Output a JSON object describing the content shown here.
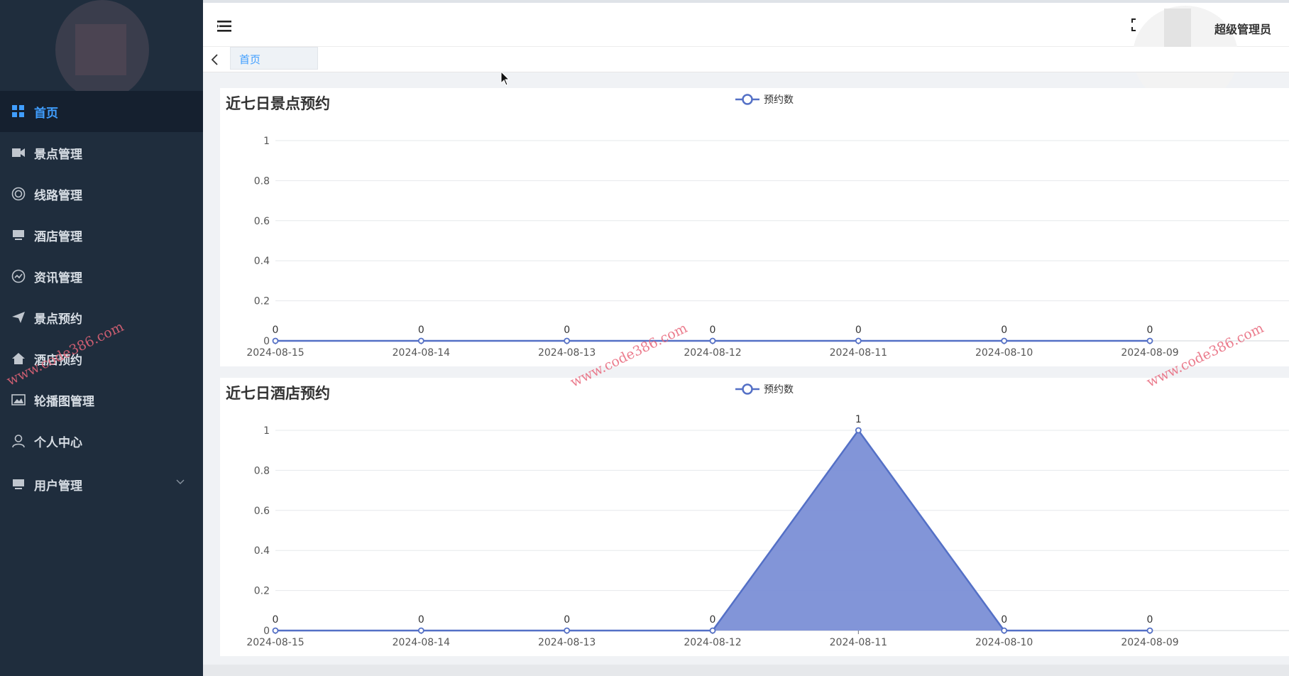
{
  "sidebar": {
    "items": [
      {
        "label": "首页",
        "icon": "dashboard-icon",
        "active": true
      },
      {
        "label": "景点管理",
        "icon": "camera-icon"
      },
      {
        "label": "线路管理",
        "icon": "target-icon"
      },
      {
        "label": "酒店管理",
        "icon": "monitor-icon"
      },
      {
        "label": "资讯管理",
        "icon": "chart-circle-icon"
      },
      {
        "label": "景点预约",
        "icon": "send-icon"
      },
      {
        "label": "酒店预约",
        "icon": "home-icon"
      },
      {
        "label": "轮播图管理",
        "icon": "picture-icon"
      },
      {
        "label": "个人中心",
        "icon": "user-icon"
      },
      {
        "label": "用户管理",
        "icon": "monitor-icon",
        "has_submenu": true
      }
    ]
  },
  "header": {
    "user_name": "超级管理员"
  },
  "tabs": {
    "home": "首页"
  },
  "watermark": "www.code386.com",
  "colors": {
    "sidebar_bg": "#1f2d3d",
    "accent": "#409eff",
    "series_line": "#5470c6",
    "area_fill": "#7b8fd6"
  },
  "charts": {
    "chart1": {
      "title": "近七日景点预约",
      "legend": "预约数"
    },
    "chart2": {
      "title": "近七日酒店预约",
      "legend": "预约数"
    }
  },
  "chart_data": [
    {
      "type": "line",
      "title": "近七日景点预约",
      "categories": [
        "2024-08-15",
        "2024-08-14",
        "2024-08-13",
        "2024-08-12",
        "2024-08-11",
        "2024-08-10",
        "2024-08-09"
      ],
      "series": [
        {
          "name": "预约数",
          "values": [
            0,
            0,
            0,
            0,
            0,
            0,
            0
          ]
        }
      ],
      "y_ticks": [
        "0",
        "0.2",
        "0.4",
        "0.6",
        "0.8",
        "1"
      ],
      "ylim": [
        0,
        1
      ],
      "grid": true,
      "legend_position": "top-center"
    },
    {
      "type": "area",
      "title": "近七日酒店预约",
      "categories": [
        "2024-08-15",
        "2024-08-14",
        "2024-08-13",
        "2024-08-12",
        "2024-08-11",
        "2024-08-10",
        "2024-08-09"
      ],
      "series": [
        {
          "name": "预约数",
          "values": [
            0,
            0,
            0,
            0,
            1,
            0,
            0
          ]
        }
      ],
      "y_ticks": [
        "0",
        "0.2",
        "0.4",
        "0.6",
        "0.8",
        "1"
      ],
      "ylim": [
        0,
        1
      ],
      "grid": true,
      "legend_position": "top-center"
    }
  ]
}
